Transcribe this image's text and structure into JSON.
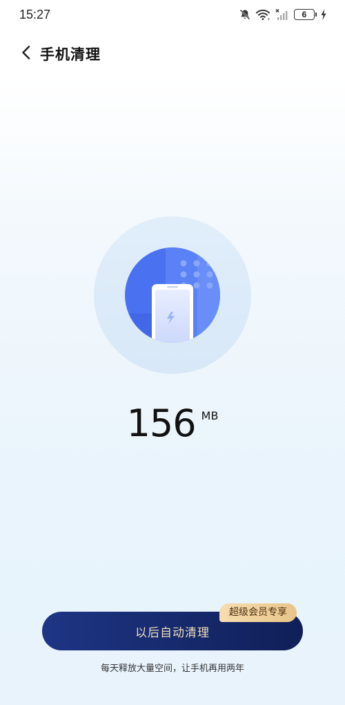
{
  "status_bar": {
    "time": "15:27",
    "battery_level": "6",
    "icons": [
      "bell-muted-icon",
      "wifi-icon",
      "signal-off-icon",
      "battery-icon",
      "charging-icon"
    ]
  },
  "header": {
    "back_icon": "chevron-left-icon",
    "title": "手机清理"
  },
  "hero": {
    "icon": "phone-clean-illustration"
  },
  "storage": {
    "value": "156",
    "unit": "MB"
  },
  "cta": {
    "label": "以后自动清理",
    "badge": "超级会员专享"
  },
  "footer": {
    "tagline": "每天释放大量空间，让手机再用两年"
  },
  "colors": {
    "hero_blue": "#4a72f0",
    "button_navy": "#16296b",
    "button_text": "#f1dfbb",
    "badge_gold": "#eecf9a"
  }
}
